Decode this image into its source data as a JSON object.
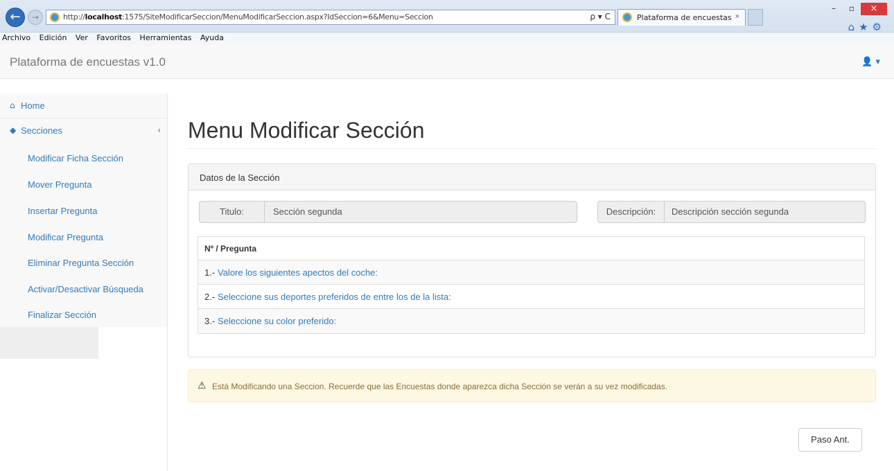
{
  "browser": {
    "url_prefix": "http://",
    "url_host": "localhost",
    "url_rest": ":1575/SiteModificarSeccion/MenuModificarSeccion.aspx?IdSeccion=6&Menu=Seccion",
    "tab_title": "Plataforma de encuestas",
    "tab_close": "×",
    "address_tools": "ρ ▾ C",
    "minimize": "–",
    "maximize": "▫",
    "close": "×",
    "toolbar_icons": "⌂★⚙",
    "menu": [
      "Archivo",
      "Edición",
      "Ver",
      "Favoritos",
      "Herramientas",
      "Ayuda"
    ]
  },
  "navbar": {
    "brand": "Plataforma de encuestas v1.0",
    "user_icon": "user-icon",
    "user_caret": "▾"
  },
  "sidebar": {
    "home": {
      "icon": "home-icon",
      "label": "Home"
    },
    "secciones": {
      "icon": "tags-icon",
      "label": "Secciones",
      "chevron": "‹"
    },
    "subitems": [
      "Modificar Ficha Sección",
      "Mover Pregunta",
      "Insertar Pregunta",
      "Modificar Pregunta",
      "Eliminar Pregunta Sección",
      "Activar/Desactivar Búsqueda",
      "Finalizar Sección"
    ]
  },
  "main": {
    "title": "Menu Modificar Sección",
    "panel": {
      "heading": "Datos de la Sección",
      "titulo_label": "Titulo:",
      "titulo_value": "Sección segunda",
      "descripcion_label": "Descripción:",
      "descripcion_value": "Descripción sección segunda",
      "table_header": "Nº / Pregunta",
      "questions": [
        {
          "num": "1.-",
          "text": "Valore los siguientes apectos del coche:"
        },
        {
          "num": "2.-",
          "text": "Seleccione sus deportes preferidos de entre los de la lista:"
        },
        {
          "num": "3.-",
          "text": "Seleccione su color preferido:"
        }
      ]
    },
    "alert": {
      "icon": "warning-icon",
      "message": "Está Modificando una Seccion. Recuerde que las Encuestas donde aparezca dicha Sección se verán a su vez modificadas."
    },
    "prev_button": "Paso Ant."
  }
}
